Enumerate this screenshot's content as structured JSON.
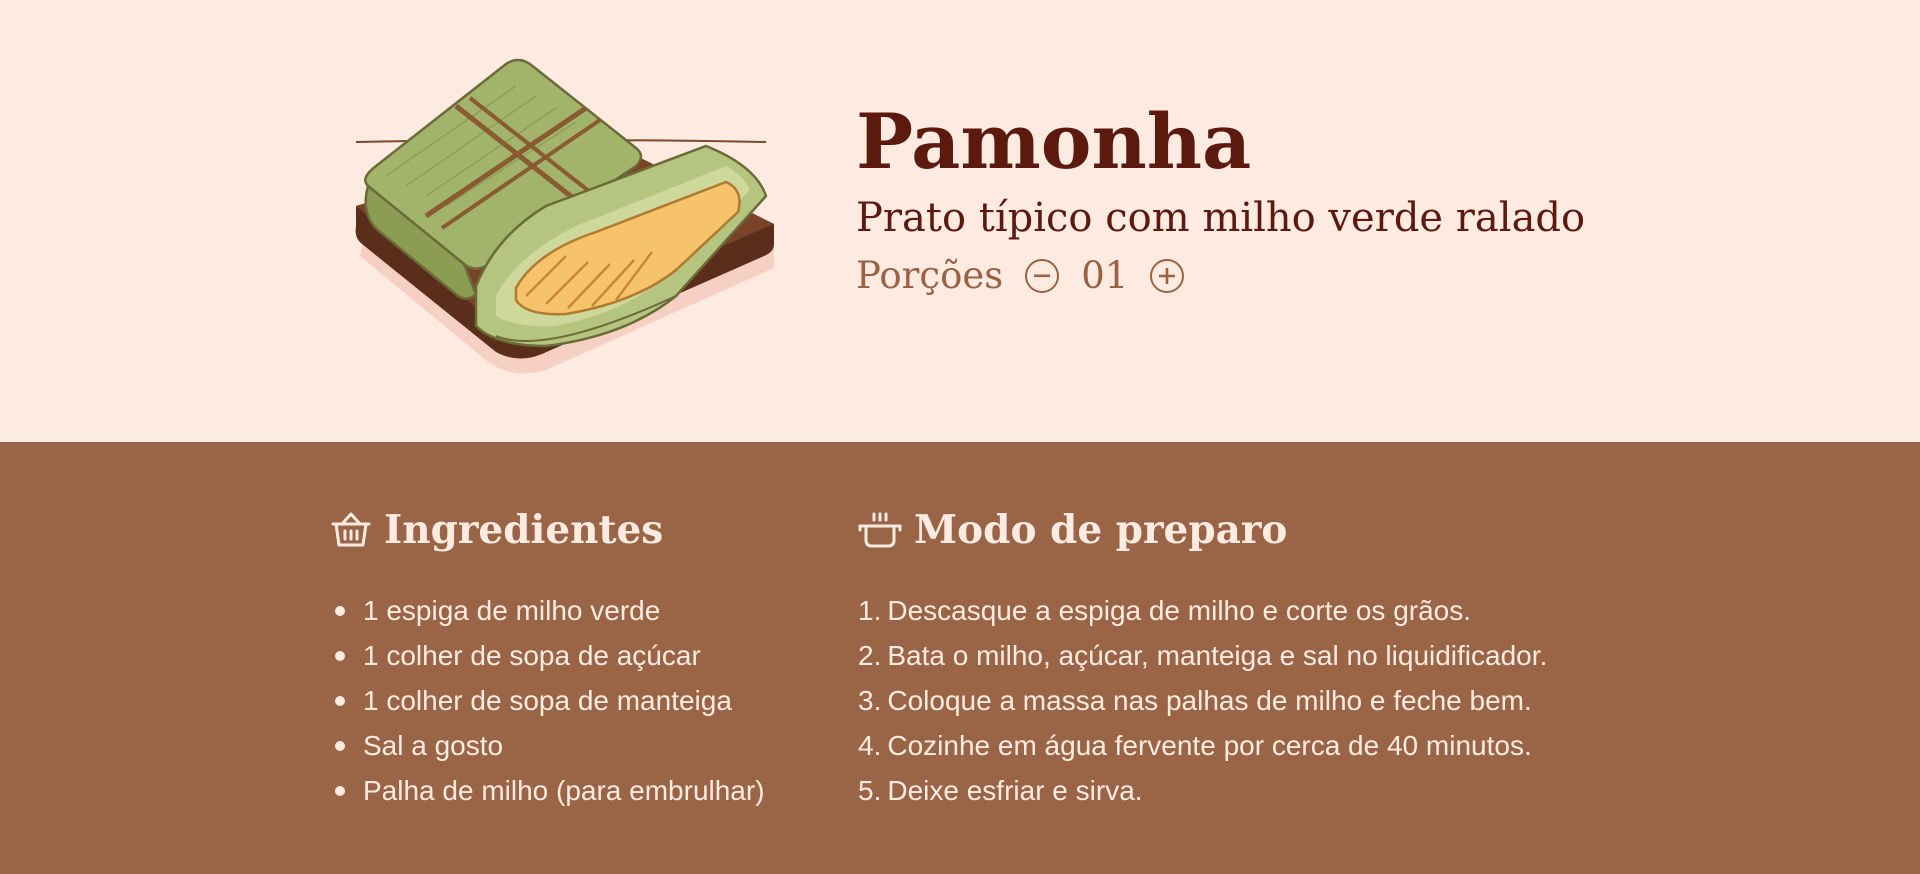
{
  "recipe": {
    "title": "Pamonha",
    "subtitle": "Prato típico com milho verde ralado",
    "servings_label": "Porções",
    "servings_count": "01"
  },
  "ingredients": {
    "heading": "Ingredientes",
    "items": [
      "1 espiga de milho verde",
      "1 colher de sopa de açúcar",
      "1 colher de sopa de manteiga",
      "Sal a gosto",
      "Palha de milho (para embrulhar)"
    ]
  },
  "steps": {
    "heading": "Modo de preparo",
    "items": [
      {
        "num": "1.",
        "text": "Descasque a espiga de milho e corte os grãos."
      },
      {
        "num": "2.",
        "text": "Bata o milho, açúcar, manteiga e sal no liquidificador."
      },
      {
        "num": "3.",
        "text": "Coloque a massa nas palhas de milho e feche bem."
      },
      {
        "num": "4.",
        "text": "Cozinhe em água fervente por cerca de 40 minutos."
      },
      {
        "num": "5.",
        "text": "Deixe esfriar e sirva."
      }
    ]
  },
  "colors": {
    "hero_bg": "#fdebe1",
    "content_bg": "#9a6446",
    "title": "#5c1a0e",
    "accent": "#9a6242",
    "light_text": "#fdebe1"
  },
  "icons": {
    "ingredients": "basket-icon",
    "steps": "pot-icon",
    "decrease": "minus-circle-icon",
    "increase": "plus-circle-icon"
  }
}
